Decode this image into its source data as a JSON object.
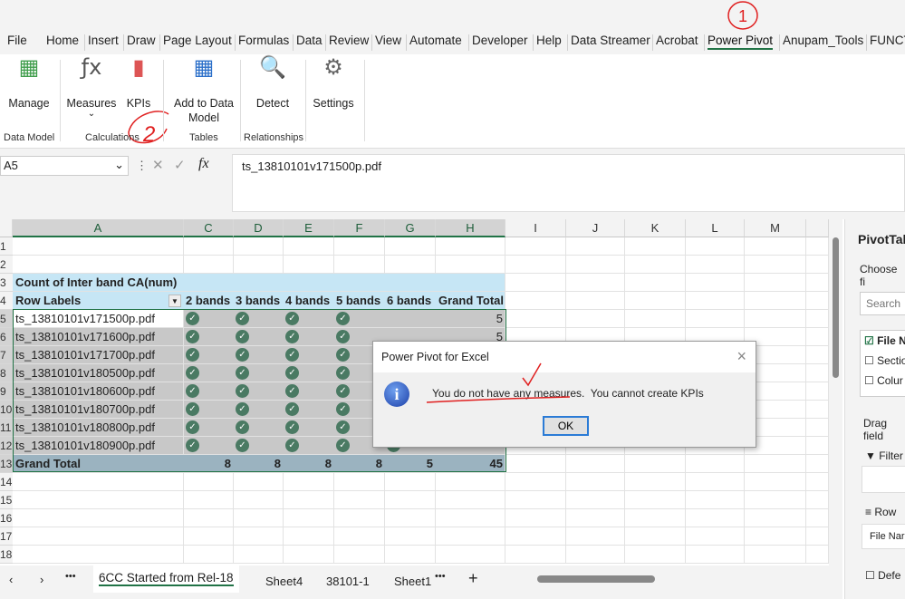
{
  "ribbon_tabs": [
    "File",
    "Home",
    "Insert",
    "Draw",
    "Page Layout",
    "Formulas",
    "Data",
    "Review",
    "View",
    "Automate",
    "Developer",
    "Help",
    "Data Streamer",
    "Acrobat",
    "Power Pivot",
    "Anupam_Tools",
    "FUNCT"
  ],
  "active_tab": "Power Pivot",
  "ribbon": {
    "manage": "Manage",
    "measures": "Measures",
    "kpis": "KPIs",
    "add_to_data_model": "Add to Data Model",
    "detect": "Detect",
    "settings": "Settings",
    "groups": {
      "data_model": "Data Model",
      "calculations": "Calculations",
      "tables": "Tables",
      "relationships": "Relationships"
    }
  },
  "annotations": {
    "one": "1",
    "two": "2"
  },
  "formula_bar": {
    "name_box": "A5",
    "fx": "fx",
    "value": "ts_13810101v171500p.pdf"
  },
  "columns": [
    "A",
    "C",
    "D",
    "E",
    "F",
    "G",
    "H",
    "I",
    "J",
    "K",
    "L",
    "M"
  ],
  "row_numbers": [
    "1",
    "2",
    "3",
    "4",
    "5",
    "6",
    "7",
    "8",
    "9",
    "10",
    "11",
    "12",
    "13",
    "14",
    "15",
    "16",
    "17",
    "18"
  ],
  "pivot": {
    "title": "Count of Inter band CA(num)",
    "row_labels": "Row Labels",
    "headers": [
      "2 bands",
      "3 bands",
      "4 bands",
      "5 bands",
      "6 bands",
      "Grand Total"
    ],
    "rows": [
      {
        "label": "ts_13810101v171500p.pdf",
        "checks": [
          1,
          1,
          1,
          1,
          0
        ],
        "total": "5"
      },
      {
        "label": "ts_13810101v171600p.pdf",
        "checks": [
          1,
          1,
          1,
          1,
          0
        ],
        "total": "5"
      },
      {
        "label": "ts_13810101v171700p.pdf",
        "checks": [
          1,
          1,
          1,
          1,
          0
        ],
        "total": ""
      },
      {
        "label": "ts_13810101v180500p.pdf",
        "checks": [
          1,
          1,
          1,
          1,
          1
        ],
        "total": ""
      },
      {
        "label": "ts_13810101v180600p.pdf",
        "checks": [
          1,
          1,
          1,
          1,
          1
        ],
        "total": ""
      },
      {
        "label": "ts_13810101v180700p.pdf",
        "checks": [
          1,
          1,
          1,
          1,
          1
        ],
        "total": ""
      },
      {
        "label": "ts_13810101v180800p.pdf",
        "checks": [
          1,
          1,
          1,
          1,
          1
        ],
        "total": ""
      },
      {
        "label": "ts_13810101v180900p.pdf",
        "checks": [
          1,
          1,
          1,
          1,
          1
        ],
        "total": ""
      }
    ],
    "grand_total": {
      "label": "Grand Total",
      "values": [
        "8",
        "8",
        "8",
        "8",
        "5",
        "45"
      ]
    }
  },
  "dialog": {
    "title": "Power Pivot for Excel",
    "message_part1": "You do not have any measures.",
    "message_part2": "You cannot create KPIs",
    "ok": "OK",
    "close": "×"
  },
  "pane": {
    "title": "PivotTab",
    "choose": "Choose fi",
    "search_placeholder": "Search",
    "fields": [
      {
        "label": "File N",
        "checked": true
      },
      {
        "label": "Sectio",
        "checked": false
      },
      {
        "label": "Colur",
        "checked": false
      }
    ],
    "drag": "Drag field",
    "filters": "Filter",
    "rows": "Row",
    "row_item": "File Nar",
    "defer": "Defe"
  },
  "sheets": {
    "active": "6CC Started from Rel-18",
    "others": [
      "Sheet4",
      "38101-1",
      "Sheet1"
    ],
    "more": "•••",
    "add": "+"
  }
}
